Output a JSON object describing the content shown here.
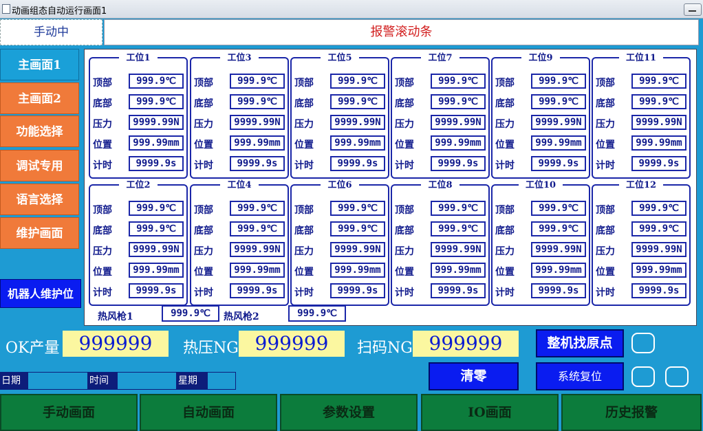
{
  "window": {
    "title": "动画组态自动运行画面1"
  },
  "top": {
    "mode": "手动中",
    "alarm_scroll": "报警滚动条"
  },
  "left_nav": [
    "主画面1",
    "主画面2",
    "功能选择",
    "调试专用",
    "语言选择",
    "维护画面"
  ],
  "robot_button": "机器人维护位",
  "field_labels": [
    "顶部",
    "底部",
    "压力",
    "位置",
    "计时"
  ],
  "stations": [
    {
      "name": "工位1",
      "values": [
        "999.9℃",
        "999.9℃",
        "9999.99N",
        "999.99mm",
        "9999.9s"
      ]
    },
    {
      "name": "工位3",
      "values": [
        "999.9℃",
        "999.9℃",
        "9999.99N",
        "999.99mm",
        "9999.9s"
      ]
    },
    {
      "name": "工位5",
      "values": [
        "999.9℃",
        "999.9℃",
        "9999.99N",
        "999.99mm",
        "9999.9s"
      ]
    },
    {
      "name": "工位7",
      "values": [
        "999.9℃",
        "999.9℃",
        "9999.99N",
        "999.99mm",
        "9999.9s"
      ]
    },
    {
      "name": "工位9",
      "values": [
        "999.9℃",
        "999.9℃",
        "9999.99N",
        "999.99mm",
        "9999.9s"
      ]
    },
    {
      "name": "工位11",
      "values": [
        "999.9℃",
        "999.9℃",
        "9999.99N",
        "999.99mm",
        "9999.9s"
      ]
    },
    {
      "name": "工位2",
      "values": [
        "999.9℃",
        "999.9℃",
        "9999.99N",
        "999.99mm",
        "9999.9s"
      ]
    },
    {
      "name": "工位4",
      "values": [
        "999.9℃",
        "999.9℃",
        "9999.99N",
        "999.99mm",
        "9999.9s"
      ]
    },
    {
      "name": "工位6",
      "values": [
        "999.9℃",
        "999.9℃",
        "9999.99N",
        "999.99mm",
        "9999.9s"
      ]
    },
    {
      "name": "工位8",
      "values": [
        "999.9℃",
        "999.9℃",
        "9999.99N",
        "999.99mm",
        "9999.9s"
      ]
    },
    {
      "name": "工位10",
      "values": [
        "999.9℃",
        "999.9℃",
        "9999.99N",
        "999.99mm",
        "9999.9s"
      ]
    },
    {
      "name": "工位12",
      "values": [
        "999.9℃",
        "999.9℃",
        "9999.99N",
        "999.99mm",
        "9999.9s"
      ]
    }
  ],
  "heat_guns": [
    {
      "label": "热风枪1",
      "value": "999.9℃"
    },
    {
      "label": "热风枪2",
      "value": "999.9℃"
    }
  ],
  "counters": {
    "ok_label": "OK产量",
    "ok_value": "999999",
    "hot_ng_label": "热压NG",
    "hot_ng_value": "999999",
    "scan_ng_label": "扫码NG",
    "scan_ng_value": "999999"
  },
  "buttons": {
    "home_all": "整机找原点",
    "clear": "清零",
    "system_reset": "系统复位"
  },
  "datetime": {
    "date_label": "日期",
    "time_label": "时间",
    "weekday_label": "星期"
  },
  "bottom_nav": [
    "手动画面",
    "自动画面",
    "参数设置",
    "IO画面",
    "历史报警"
  ],
  "colors": {
    "background": "#1e9bd3",
    "nav_orange": "#f07a3a",
    "nav_green": "#0c7c3c",
    "button_blue": "#0a1cf0",
    "counter_yellow": "#fbf7a0",
    "alarm_red": "#d21e1e"
  }
}
